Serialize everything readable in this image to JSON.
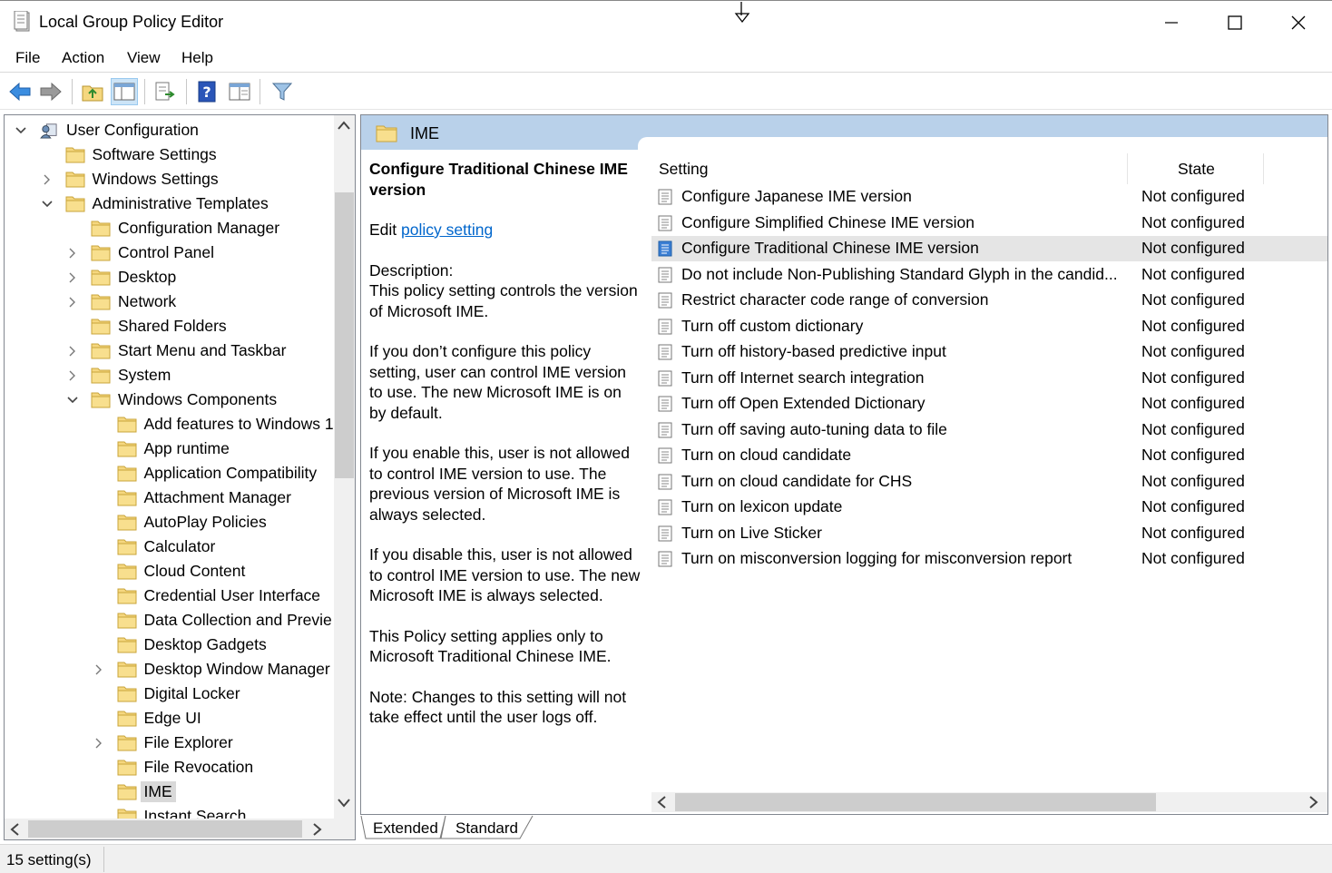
{
  "window": {
    "title": "Local Group Policy Editor"
  },
  "menu": {
    "file": "File",
    "action": "Action",
    "view": "View",
    "help": "Help"
  },
  "tree": {
    "items": [
      {
        "label": "User Configuration",
        "level": 0,
        "chevron": "down",
        "icon": "user-config-icon"
      },
      {
        "label": "Software Settings",
        "level": 1,
        "chevron": "none",
        "icon": "folder-icon"
      },
      {
        "label": "Windows Settings",
        "level": 1,
        "chevron": "right",
        "icon": "folder-icon"
      },
      {
        "label": "Administrative Templates",
        "level": 1,
        "chevron": "down",
        "icon": "folder-icon"
      },
      {
        "label": "Configuration Manager",
        "level": 2,
        "chevron": "none",
        "icon": "folder-icon"
      },
      {
        "label": "Control Panel",
        "level": 2,
        "chevron": "right",
        "icon": "folder-icon"
      },
      {
        "label": "Desktop",
        "level": 2,
        "chevron": "right",
        "icon": "folder-icon"
      },
      {
        "label": "Network",
        "level": 2,
        "chevron": "right",
        "icon": "folder-icon"
      },
      {
        "label": "Shared Folders",
        "level": 2,
        "chevron": "none",
        "icon": "folder-icon"
      },
      {
        "label": "Start Menu and Taskbar",
        "level": 2,
        "chevron": "right",
        "icon": "folder-icon"
      },
      {
        "label": "System",
        "level": 2,
        "chevron": "right",
        "icon": "folder-icon"
      },
      {
        "label": "Windows Components",
        "level": 2,
        "chevron": "down",
        "icon": "folder-icon"
      },
      {
        "label": "Add features to Windows 1",
        "level": 3,
        "chevron": "none",
        "icon": "folder-icon"
      },
      {
        "label": "App runtime",
        "level": 3,
        "chevron": "none",
        "icon": "folder-icon"
      },
      {
        "label": "Application Compatibility",
        "level": 3,
        "chevron": "none",
        "icon": "folder-icon"
      },
      {
        "label": "Attachment Manager",
        "level": 3,
        "chevron": "none",
        "icon": "folder-icon"
      },
      {
        "label": "AutoPlay Policies",
        "level": 3,
        "chevron": "none",
        "icon": "folder-icon"
      },
      {
        "label": "Calculator",
        "level": 3,
        "chevron": "none",
        "icon": "folder-icon"
      },
      {
        "label": "Cloud Content",
        "level": 3,
        "chevron": "none",
        "icon": "folder-icon"
      },
      {
        "label": "Credential User Interface",
        "level": 3,
        "chevron": "none",
        "icon": "folder-icon"
      },
      {
        "label": "Data Collection and Previe",
        "level": 3,
        "chevron": "none",
        "icon": "folder-icon"
      },
      {
        "label": "Desktop Gadgets",
        "level": 3,
        "chevron": "none",
        "icon": "folder-icon"
      },
      {
        "label": "Desktop Window Manager",
        "level": 3,
        "chevron": "right",
        "icon": "folder-icon"
      },
      {
        "label": "Digital Locker",
        "level": 3,
        "chevron": "none",
        "icon": "folder-icon"
      },
      {
        "label": "Edge UI",
        "level": 3,
        "chevron": "none",
        "icon": "folder-icon"
      },
      {
        "label": "File Explorer",
        "level": 3,
        "chevron": "right",
        "icon": "folder-icon"
      },
      {
        "label": "File Revocation",
        "level": 3,
        "chevron": "none",
        "icon": "folder-icon"
      },
      {
        "label": "IME",
        "level": 3,
        "chevron": "none",
        "icon": "folder-icon",
        "selected": true
      },
      {
        "label": "Instant Search",
        "level": 3,
        "chevron": "none",
        "icon": "folder-icon"
      }
    ]
  },
  "details": {
    "folder_title": "IME",
    "policy_title": "Configure Traditional Chinese IME version",
    "edit_prefix": "Edit ",
    "edit_link": "policy setting ",
    "description_label": "Description:",
    "paragraphs": [
      "This policy setting controls the version of Microsoft IME.",
      "If you don’t configure this policy setting, user can control IME version to use. The new Microsoft IME is on by default.",
      "If you enable this, user is not allowed to control IME version to use. The previous version of Microsoft IME is always selected.",
      "If you disable this, user is not allowed to control IME version to use. The new Microsoft IME is always selected.",
      "This Policy setting applies only to Microsoft Traditional Chinese IME.",
      "Note: Changes to this setting will not take effect until the user logs off."
    ]
  },
  "list": {
    "col_setting": "Setting",
    "col_state": "State",
    "rows": [
      {
        "name": "Configure Japanese IME version",
        "state": "Not configured"
      },
      {
        "name": "Configure Simplified Chinese IME version",
        "state": "Not configured"
      },
      {
        "name": "Configure Traditional Chinese IME version",
        "state": "Not configured",
        "selected": true
      },
      {
        "name": "Do not include Non-Publishing Standard Glyph in the candid...",
        "state": "Not configured"
      },
      {
        "name": "Restrict character code range of conversion",
        "state": "Not configured"
      },
      {
        "name": "Turn off custom dictionary",
        "state": "Not configured"
      },
      {
        "name": "Turn off history-based predictive input",
        "state": "Not configured"
      },
      {
        "name": "Turn off Internet search integration",
        "state": "Not configured"
      },
      {
        "name": "Turn off Open Extended Dictionary",
        "state": "Not configured"
      },
      {
        "name": "Turn off saving auto-tuning data to file",
        "state": "Not configured"
      },
      {
        "name": "Turn on cloud candidate",
        "state": "Not configured"
      },
      {
        "name": "Turn on cloud candidate for CHS",
        "state": "Not configured"
      },
      {
        "name": "Turn on lexicon update",
        "state": "Not configured"
      },
      {
        "name": "Turn on Live Sticker",
        "state": "Not configured"
      },
      {
        "name": "Turn on misconversion logging for misconversion report",
        "state": "Not configured"
      }
    ]
  },
  "tabs": {
    "extended": "Extended",
    "standard": "Standard"
  },
  "status": {
    "text": "15 setting(s)"
  },
  "colors": {
    "header_band": "#b9d1ea",
    "link": "#0066cc",
    "selection": "#e5e5e5",
    "folder": "#f5d77f"
  }
}
